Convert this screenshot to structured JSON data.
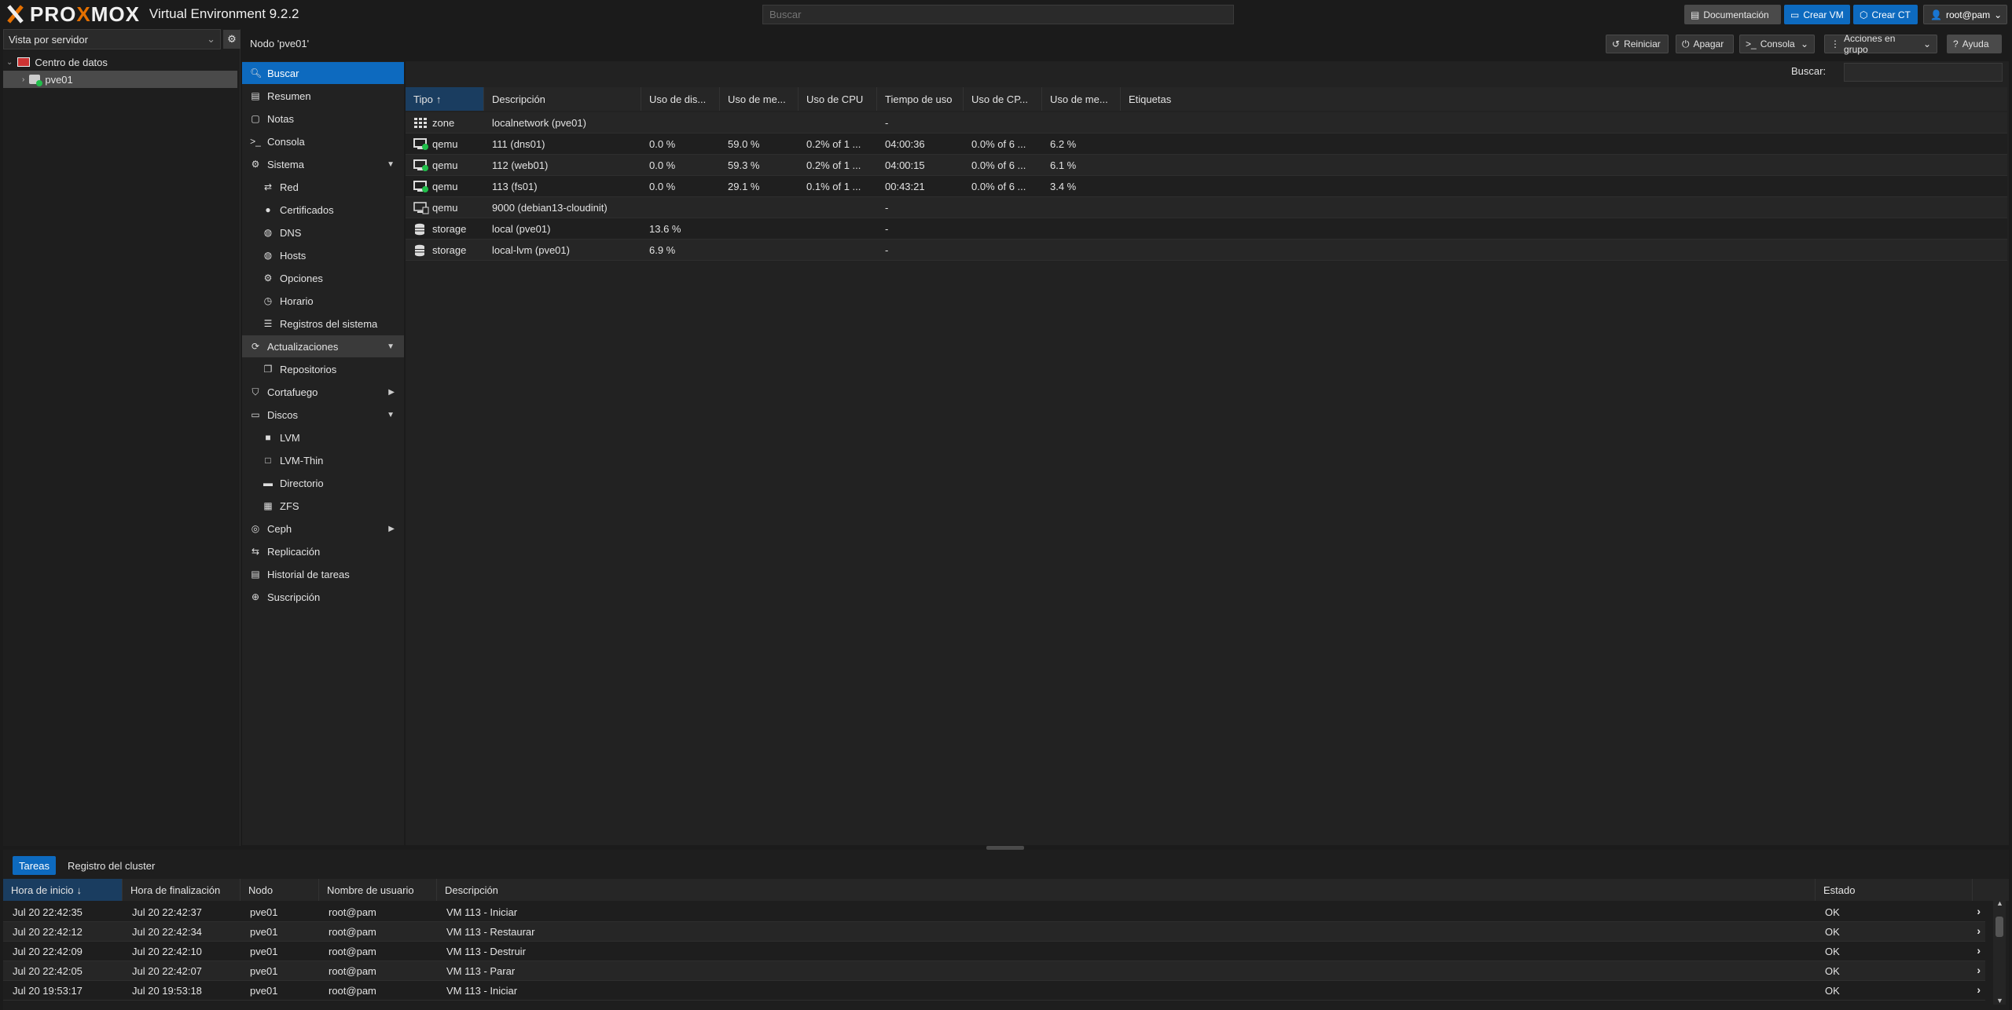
{
  "topbar": {
    "brand_prefix": "PRO",
    "brand_x": "X",
    "brand_suffix": "MOX",
    "product": "Virtual Environment 9.2.2",
    "search_placeholder": "Buscar",
    "doc_label": "Documentación",
    "create_vm_label": "Crear VM",
    "create_ct_label": "Crear CT",
    "user_label": "root@pam"
  },
  "tree": {
    "view_label": "Vista por servidor",
    "datacenter": "Centro de datos",
    "node": "pve01"
  },
  "header": {
    "title": "Nodo 'pve01'",
    "reboot_label": "Reiniciar",
    "shutdown_label": "Apagar",
    "console_label": "Consola",
    "bulk_label": "Acciones en grupo",
    "help_label": "Ayuda"
  },
  "menu": {
    "items": [
      {
        "label": "Buscar",
        "icon": "search-icon"
      },
      {
        "label": "Resumen",
        "icon": "book-icon"
      },
      {
        "label": "Notas",
        "icon": "notes-icon"
      },
      {
        "label": "Consola",
        "icon": "terminal-icon"
      },
      {
        "label": "Sistema",
        "icon": "gears-icon"
      },
      {
        "label": "Red",
        "icon": "exchange-icon"
      },
      {
        "label": "Certificados",
        "icon": "certificate-icon"
      },
      {
        "label": "DNS",
        "icon": "globe-icon"
      },
      {
        "label": "Hosts",
        "icon": "globe-icon"
      },
      {
        "label": "Opciones",
        "icon": "gear-icon"
      },
      {
        "label": "Horario",
        "icon": "clock-icon"
      },
      {
        "label": "Registros del sistema",
        "icon": "list-icon"
      },
      {
        "label": "Actualizaciones",
        "icon": "refresh-icon"
      },
      {
        "label": "Repositorios",
        "icon": "files-icon"
      },
      {
        "label": "Cortafuego",
        "icon": "shield-icon"
      },
      {
        "label": "Discos",
        "icon": "hdd-icon"
      },
      {
        "label": "LVM",
        "icon": "square-icon"
      },
      {
        "label": "LVM-Thin",
        "icon": "square-outline-icon"
      },
      {
        "label": "Directorio",
        "icon": "folder-icon"
      },
      {
        "label": "ZFS",
        "icon": "grid-icon"
      },
      {
        "label": "Ceph",
        "icon": "ceph-icon"
      },
      {
        "label": "Replicación",
        "icon": "retweet-icon"
      },
      {
        "label": "Historial de tareas",
        "icon": "list-alt-icon"
      },
      {
        "label": "Suscripción",
        "icon": "support-icon"
      }
    ]
  },
  "grid": {
    "search_label": "Buscar:",
    "columns": [
      "Tipo",
      "Descripción",
      "Uso de dis...",
      "Uso de me...",
      "Uso de CPU",
      "Tiempo de uso",
      "Uso de CP...",
      "Uso de me...",
      "Etiquetas"
    ],
    "rows": [
      {
        "icon": "zone-icon",
        "type": "zone",
        "desc": "localnetwork (pve01)",
        "disk": "",
        "mem": "",
        "cpu": "",
        "uptime": "-",
        "cpu2": "",
        "mem2": "",
        "tags": ""
      },
      {
        "icon": "vm-running-icon",
        "type": "qemu",
        "desc": "111 (dns01)",
        "disk": "0.0 %",
        "mem": "59.0 %",
        "cpu": "0.2% of 1 ...",
        "uptime": "04:00:36",
        "cpu2": "0.0% of 6 ...",
        "mem2": "6.2 %",
        "tags": ""
      },
      {
        "icon": "vm-running-icon",
        "type": "qemu",
        "desc": "112 (web01)",
        "disk": "0.0 %",
        "mem": "59.3 %",
        "cpu": "0.2% of 1 ...",
        "uptime": "04:00:15",
        "cpu2": "0.0% of 6 ...",
        "mem2": "6.1 %",
        "tags": ""
      },
      {
        "icon": "vm-running-icon",
        "type": "qemu",
        "desc": "113 (fs01)",
        "disk": "0.0 %",
        "mem": "29.1 %",
        "cpu": "0.1% of 1 ...",
        "uptime": "00:43:21",
        "cpu2": "0.0% of 6 ...",
        "mem2": "3.4 %",
        "tags": ""
      },
      {
        "icon": "vm-template-icon",
        "type": "qemu",
        "desc": "9000 (debian13-cloudinit)",
        "disk": "",
        "mem": "",
        "cpu": "",
        "uptime": "-",
        "cpu2": "",
        "mem2": "",
        "tags": ""
      },
      {
        "icon": "storage-icon",
        "type": "storage",
        "desc": "local (pve01)",
        "disk": "13.6 %",
        "mem": "",
        "cpu": "",
        "uptime": "-",
        "cpu2": "",
        "mem2": "",
        "tags": ""
      },
      {
        "icon": "storage-icon",
        "type": "storage",
        "desc": "local-lvm (pve01)",
        "disk": "6.9 %",
        "mem": "",
        "cpu": "",
        "uptime": "-",
        "cpu2": "",
        "mem2": "",
        "tags": ""
      }
    ]
  },
  "bottom": {
    "tabs": [
      "Tareas",
      "Registro del cluster"
    ],
    "columns": [
      "Hora de inicio",
      "Hora de finalización",
      "Nodo",
      "Nombre de usuario",
      "Descripción",
      "Estado"
    ],
    "rows": [
      {
        "start": "Jul 20 22:42:35",
        "end": "Jul 20 22:42:37",
        "node": "pve01",
        "user": "root@pam",
        "desc": "VM 113 - Iniciar",
        "status": "OK"
      },
      {
        "start": "Jul 20 22:42:12",
        "end": "Jul 20 22:42:34",
        "node": "pve01",
        "user": "root@pam",
        "desc": "VM 113 - Restaurar",
        "status": "OK"
      },
      {
        "start": "Jul 20 22:42:09",
        "end": "Jul 20 22:42:10",
        "node": "pve01",
        "user": "root@pam",
        "desc": "VM 113 - Destruir",
        "status": "OK"
      },
      {
        "start": "Jul 20 22:42:05",
        "end": "Jul 20 22:42:07",
        "node": "pve01",
        "user": "root@pam",
        "desc": "VM 113 - Parar",
        "status": "OK"
      },
      {
        "start": "Jul 20 19:53:17",
        "end": "Jul 20 19:53:18",
        "node": "pve01",
        "user": "root@pam",
        "desc": "VM 113 - Iniciar",
        "status": "OK"
      }
    ]
  },
  "colors": {
    "accent": "#0d6abf",
    "brand": "#e57000",
    "running": "#21bf4b"
  }
}
